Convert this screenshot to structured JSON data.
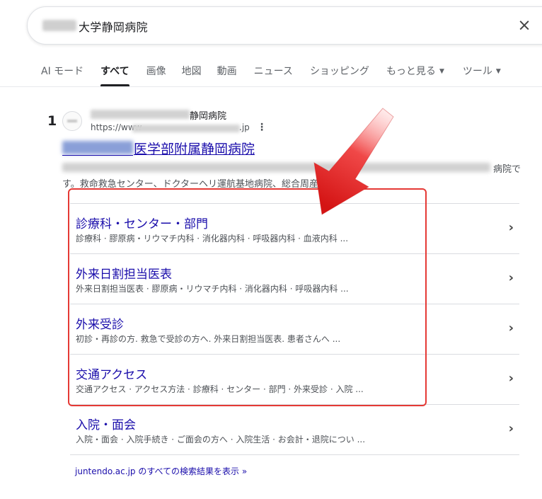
{
  "search": {
    "query_visible": "大学静岡病院",
    "clear_icon": "×"
  },
  "tabs": [
    {
      "label": "AI モード"
    },
    {
      "label": "すべて",
      "active": true
    },
    {
      "label": "画像"
    },
    {
      "label": "地図"
    },
    {
      "label": "動画"
    },
    {
      "label": "ニュース"
    },
    {
      "label": "ショッピング"
    },
    {
      "label": "もっと見る",
      "dropdown": true
    },
    {
      "label": "ツール",
      "dropdown": true
    }
  ],
  "result": {
    "rank": "1",
    "site_name_visible": "静岡病院",
    "url_start": "https://www",
    "url_end": ".jp",
    "title_visible": "医学部附属静岡病院",
    "snippet_line1_end": "病院で",
    "snippet_line2": "す。救命救急センター、ドクターヘリ運航基地病院、総合周産期母子 ..."
  },
  "sitelinks": [
    {
      "title": "診療科・センター・部門",
      "desc": "診療科 · 膠原病・リウマチ内科 · 消化器内科 · 呼吸器内科 · 血液内科 ..."
    },
    {
      "title": "外来日割担当医表",
      "desc": "外来日割担当医表 · 膠原病・リウマチ内科 · 消化器内科 · 呼吸器内科 ..."
    },
    {
      "title": "外来受診",
      "desc": "初診・再診の方. 救急で受診の方へ. 外来日割担当医表. 患者さんへ ..."
    },
    {
      "title": "交通アクセス",
      "desc": "交通アクセス · アクセス方法 · 診療科 · センター · 部門 · 外来受診 · 入院 ..."
    },
    {
      "title": "入院・面会",
      "desc": "入院・面会 · 入院手続き · ご面会の方へ · 入院生活 · お会計・退院につい ..."
    }
  ],
  "all_results_link": "juntendo.ac.jp のすべての検索結果を表示 »",
  "colors": {
    "link": "#1a0dab",
    "annotation": "#e53935"
  }
}
